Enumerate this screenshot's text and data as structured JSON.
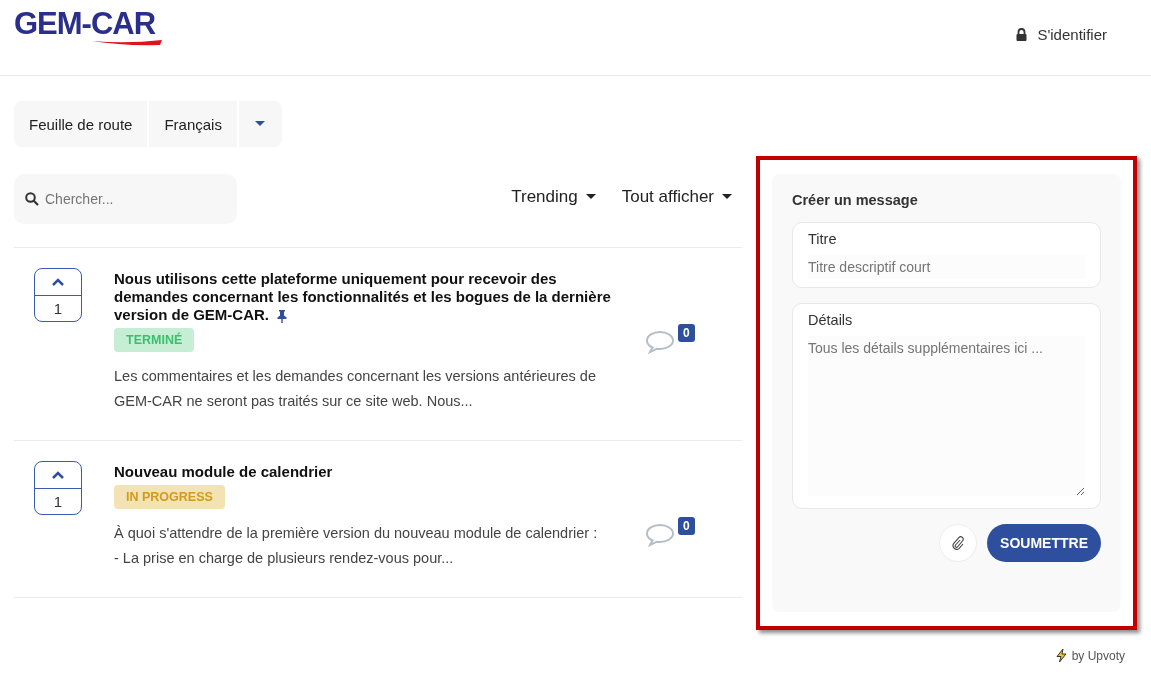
{
  "header": {
    "logo": "GEM-CAR",
    "login": "S'identifier"
  },
  "nav": {
    "tabs": [
      {
        "label": "Feuille de route",
        "selected": false
      },
      {
        "label": "Français",
        "selected": false
      }
    ]
  },
  "search": {
    "placeholder": "Chercher..."
  },
  "filters": [
    {
      "label": "Trending"
    },
    {
      "label": "Tout afficher"
    }
  ],
  "posts": [
    {
      "votes": "1",
      "title": "Nous utilisons cette plateforme uniquement pour recevoir des demandes concernant les fonctionnalités et les bogues de la dernière version de GEM-CAR.",
      "pinned": true,
      "status": {
        "label": "TERMINÉ",
        "kind": "done"
      },
      "excerpt": [
        "Les commentaires et les demandes concernant les versions antérieures de",
        "GEM-CAR ne seront pas traités sur ce site web. Nous..."
      ],
      "comments": "0"
    },
    {
      "votes": "1",
      "title": "Nouveau module de calendrier",
      "pinned": false,
      "status": {
        "label": "IN PROGRESS",
        "kind": "progress"
      },
      "excerpt": [
        "À quoi s'attendre de la première version du nouveau module de calendrier :",
        "- La prise en charge de plusieurs rendez-vous pour..."
      ],
      "comments": "0"
    }
  ],
  "form": {
    "heading": "Créer un message",
    "fields": [
      {
        "label": "Titre",
        "placeholder": "Titre descriptif court",
        "kind": "input"
      },
      {
        "label": "Détails",
        "placeholder": "Tous les détails supplémentaires ici ...",
        "kind": "textarea"
      }
    ],
    "submit": "SOUMETTRE"
  },
  "footer": {
    "credit": "by Upvoty"
  }
}
